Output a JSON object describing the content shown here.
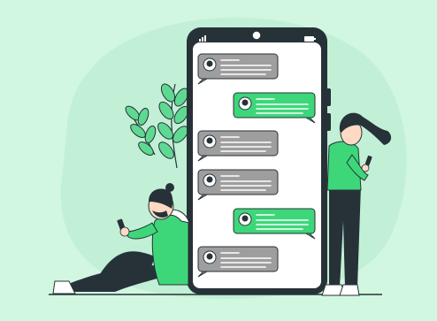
{
  "scene": {
    "description_free": true
  },
  "colors": {
    "background": "#d2f7e1",
    "blob": "#c2f0d6",
    "phone_body": "#263238",
    "screen": "#ffffff",
    "accent_green": "#3dd77a",
    "incoming_bubble": "#9e9e9e",
    "text_line": "#ffffff",
    "plant": "#5fd992",
    "skin": "#ffd9c4",
    "hair": "#263238",
    "shoe": "#ffffff"
  },
  "icons": {
    "signal": "signal-bars-icon",
    "camera": "front-camera-icon",
    "battery": "battery-icon",
    "avatar": "user-avatar-icon"
  },
  "chat": {
    "messages": [
      {
        "side": "left",
        "kind": "incoming"
      },
      {
        "side": "right",
        "kind": "outgoing"
      },
      {
        "side": "left",
        "kind": "incoming"
      },
      {
        "side": "left",
        "kind": "incoming"
      },
      {
        "side": "right",
        "kind": "outgoing"
      },
      {
        "side": "left",
        "kind": "incoming"
      }
    ]
  }
}
